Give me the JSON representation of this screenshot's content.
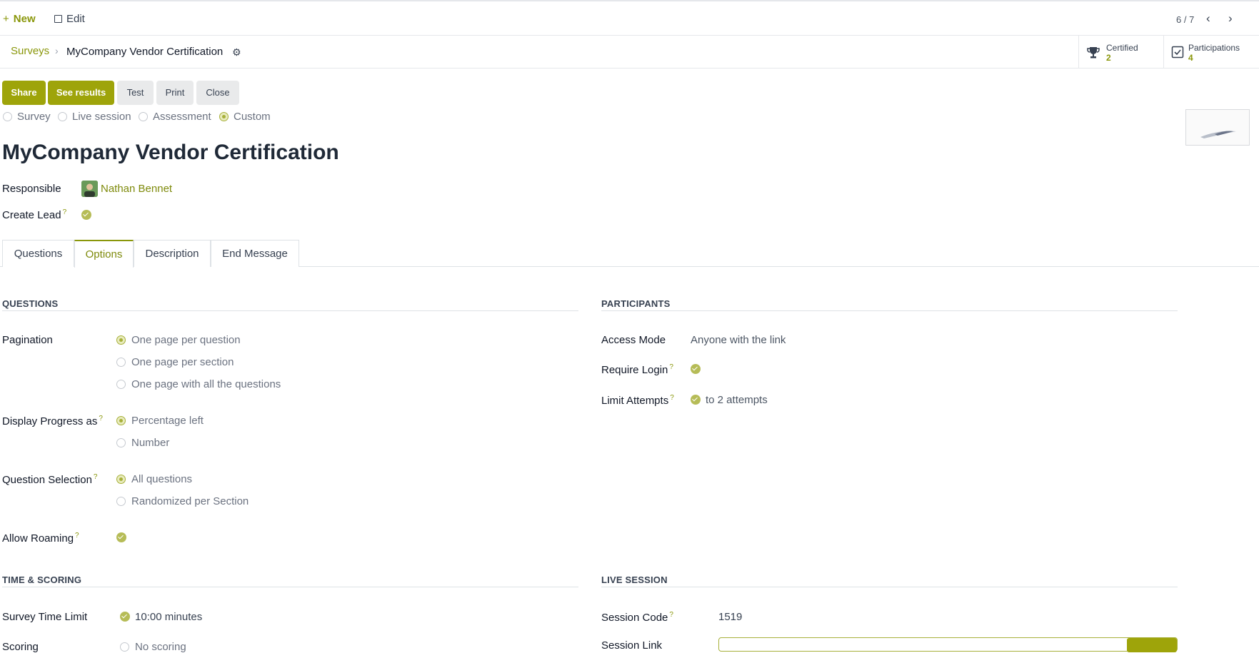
{
  "topbar": {
    "new_label": "New",
    "edit_label": "Edit",
    "pager": "6 / 7"
  },
  "breadcrumb": {
    "parent": "Surveys",
    "current": "MyCompany Vendor Certification"
  },
  "stats": [
    {
      "label": "Certified",
      "value": "2",
      "icon": "trophy-icon"
    },
    {
      "label": "Participations",
      "value": "4",
      "icon": "checkbox-icon"
    }
  ],
  "actions": {
    "share": "Share",
    "see_results": "See results",
    "test": "Test",
    "print": "Print",
    "close": "Close"
  },
  "survey_types": {
    "selected": "Custom",
    "options": [
      "Survey",
      "Live session",
      "Assessment",
      "Custom"
    ]
  },
  "title": "MyCompany Vendor Certification",
  "fields": {
    "responsible_label": "Responsible",
    "responsible_value": "Nathan Bennet",
    "create_lead_label": "Create Lead",
    "create_lead_value": true
  },
  "tabs": {
    "active": "Options",
    "items": [
      "Questions",
      "Options",
      "Description",
      "End Message"
    ]
  },
  "questions_section": {
    "heading": "QUESTIONS",
    "pagination_label": "Pagination",
    "pagination_options": [
      "One page per question",
      "One page per section",
      "One page with all the questions"
    ],
    "pagination_selected": "One page per question",
    "progress_label": "Display Progress as",
    "progress_options": [
      "Percentage left",
      "Number"
    ],
    "progress_selected": "Percentage left",
    "selection_label": "Question Selection",
    "selection_options": [
      "All questions",
      "Randomized per Section"
    ],
    "selection_selected": "All questions",
    "roaming_label": "Allow Roaming",
    "roaming_value": true
  },
  "participants_section": {
    "heading": "PARTICIPANTS",
    "access_label": "Access Mode",
    "access_value": "Anyone with the link",
    "login_label": "Require Login",
    "login_value": true,
    "attempts_label": "Limit Attempts",
    "attempts_value": "to 2 attempts"
  },
  "time_section": {
    "heading": "TIME & SCORING",
    "time_limit_label": "Survey Time Limit",
    "time_limit_value": "10:00 minutes",
    "scoring_label": "Scoring",
    "scoring_value": "No scoring"
  },
  "live_section": {
    "heading": "LIVE SESSION",
    "code_label": "Session Code",
    "code_value": "1519",
    "link_label": "Session Link"
  },
  "colors": {
    "accent": "#8a970b",
    "primary_button": "#9ea40a",
    "secondary_button": "#e9eaeb"
  }
}
